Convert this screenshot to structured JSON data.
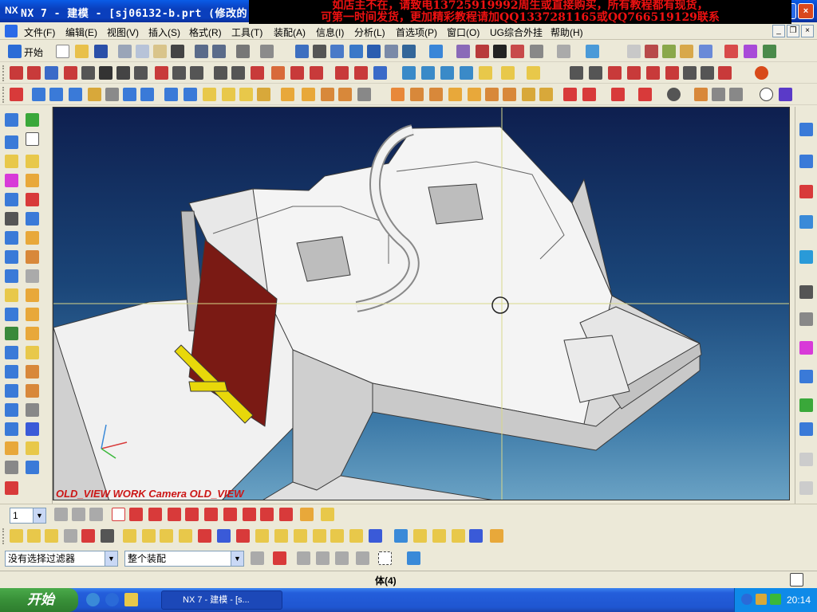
{
  "window": {
    "logo": "NX",
    "title": "NX 7 - 建模 - [sj06132-b.prt  (修改的)",
    "minimize": "_",
    "maximize": "□",
    "close": "×"
  },
  "banner": {
    "line1": "如店主不在，请致电13725919992周生或直接购买，所有教程都有现货，",
    "line2": "可第一时间发货，更加精彩教程请加QQ1337281165或QQ766519129联系"
  },
  "menu": [
    {
      "label": "文件(F)"
    },
    {
      "label": "编辑(E)"
    },
    {
      "label": "视图(V)"
    },
    {
      "label": "插入(S)"
    },
    {
      "label": "格式(R)"
    },
    {
      "label": "工具(T)"
    },
    {
      "label": "装配(A)"
    },
    {
      "label": "信息(I)"
    },
    {
      "label": "分析(L)"
    },
    {
      "label": "首选项(P)"
    },
    {
      "label": "窗口(O)"
    },
    {
      "label": "UG综合外挂"
    },
    {
      "label": "帮助(H)"
    }
  ],
  "toolbar": {
    "start_label": "开始",
    "layer_value": "1"
  },
  "viewport": {
    "caption": "OLD_VIEW WORK Camera OLD_VIEW"
  },
  "filters": {
    "selection_filter": "没有选择过滤器",
    "assembly_scope": "整个装配"
  },
  "status": {
    "message": "体(4)"
  },
  "taskbar": {
    "start": "开始",
    "task_label": "NX 7 - 建模 - [s...",
    "clock": "20:14"
  },
  "colors": {
    "background_top": "#0e1f4f",
    "background_bottom": "#6aa2c4",
    "part_face": "#f0f0f0",
    "highlight_face": "#7a1a14",
    "highlight_edge": "#e8d80a"
  }
}
